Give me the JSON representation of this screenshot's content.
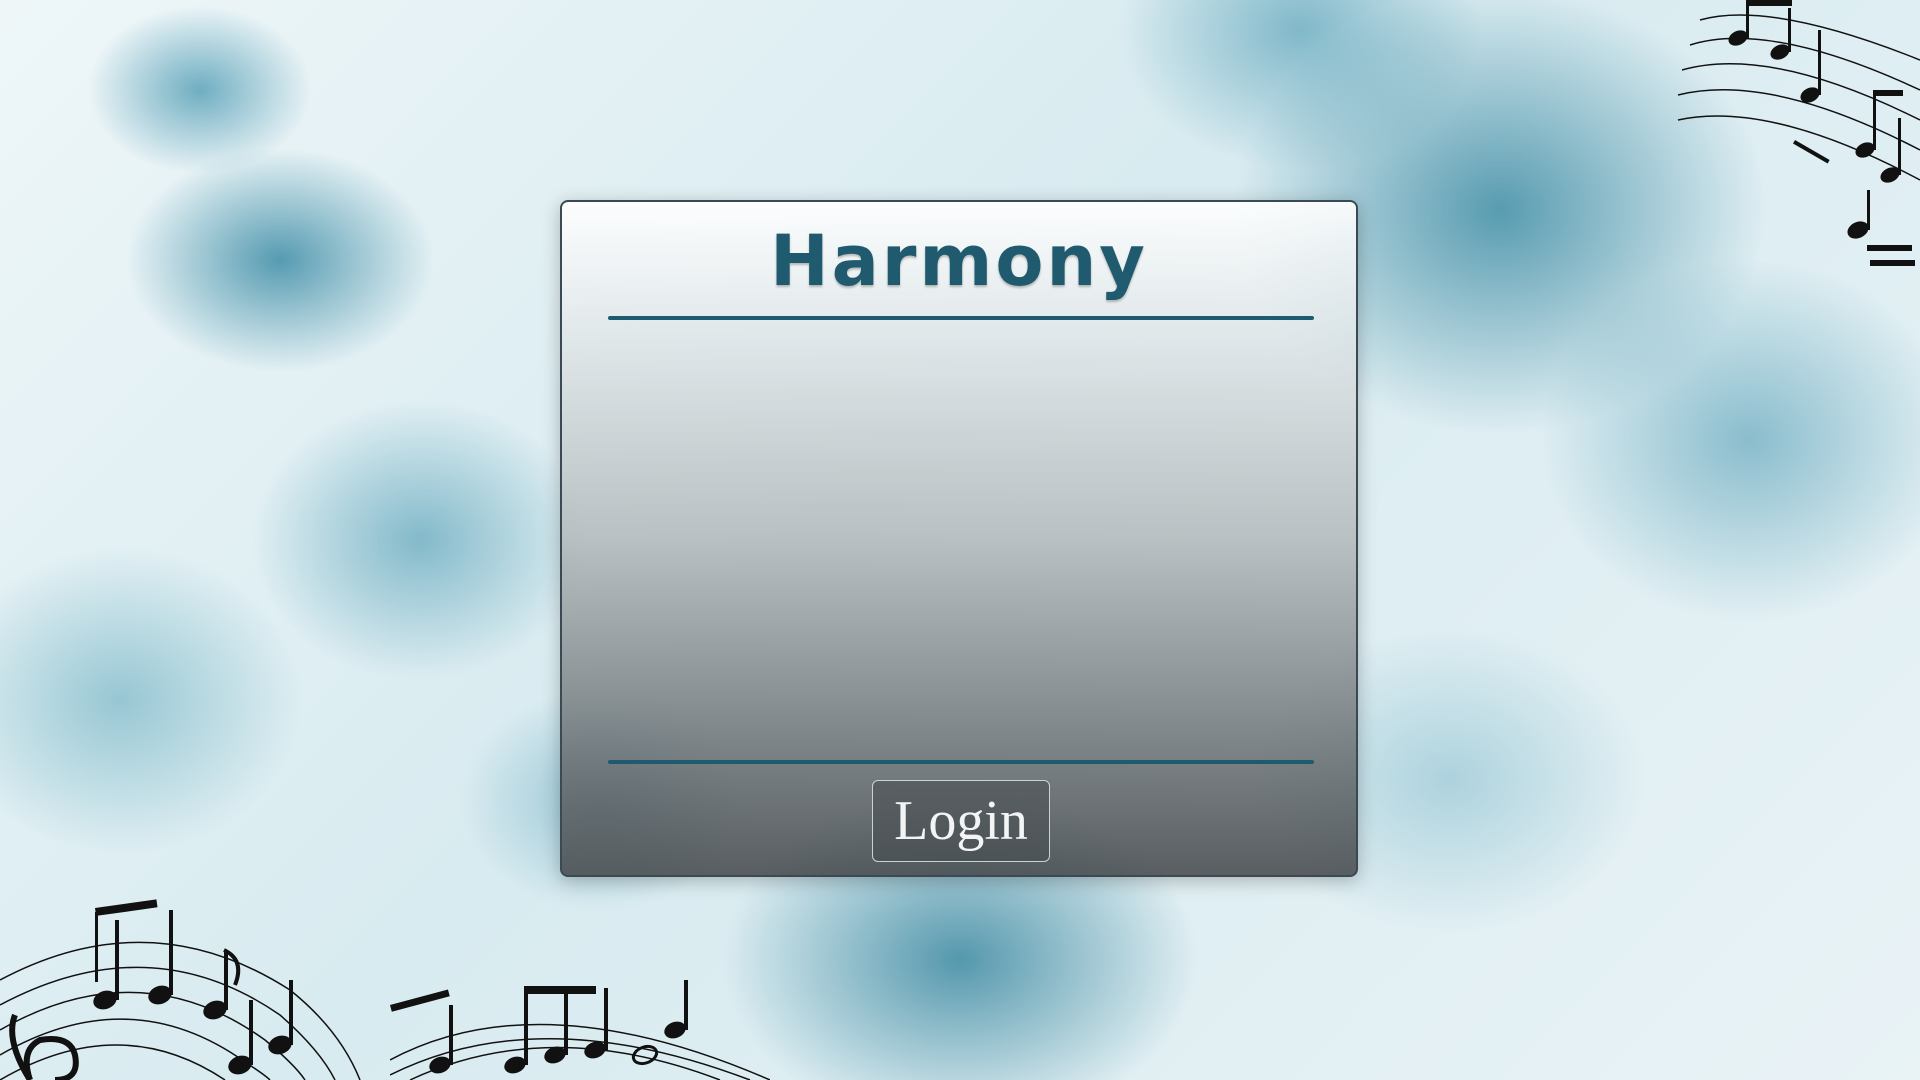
{
  "app": {
    "title": "Harmony"
  },
  "login": {
    "button_label": "Login"
  },
  "colors": {
    "accent": "#1f5a6e",
    "background": "#d8ebf0"
  },
  "decorations": [
    "music-notes-icon",
    "treble-clef-icon"
  ]
}
